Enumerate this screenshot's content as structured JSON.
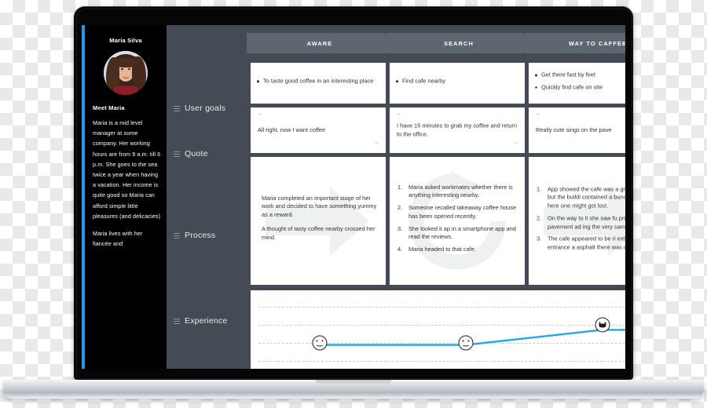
{
  "persona": {
    "name": "Maria Silva",
    "meet_title": "Meet Maria",
    "bio_paragraphs": [
      "Maria is a mid level manager at some company. Her working hours are from 9 a.m. till 6 p.m. She goes to the sea twice a year when having a vacation. Her income is quite good so Maria can afford simple little pleasures (and delicacies)",
      "Maria lives with her fiancée and"
    ]
  },
  "stages": [
    {
      "label": "AWARE"
    },
    {
      "label": "SEARCH"
    },
    {
      "label": "WAY TO CAFFEE"
    }
  ],
  "rows": [
    {
      "label": "User goals"
    },
    {
      "label": "Quote"
    },
    {
      "label": "Process"
    },
    {
      "label": "Experience"
    }
  ],
  "user_goals": [
    {
      "items": [
        "To taste good coffee in an interesting place"
      ]
    },
    {
      "items": [
        "Find cafe nearby"
      ]
    },
    {
      "items": [
        "Get there fast by feet",
        "Quickly find cafe on site"
      ]
    }
  ],
  "quotes": [
    {
      "text": "All right, now I want coffee",
      "open": "“",
      "close": "”"
    },
    {
      "text": "I have 15 minutes to grab my coffee and return to the office.",
      "open": "“",
      "close": "”"
    },
    {
      "text": "Really cute sings on the pave",
      "open": "“",
      "close": "”"
    }
  ],
  "process": [
    {
      "type": "paragraphs",
      "paragraphs": [
        "Maria completed an important stage of her work and decided to have something yummy as a reward.",
        "A thought of tasty coffee nearby crossed her mind."
      ]
    },
    {
      "type": "ordered",
      "items": [
        "Maria asked workmates whether there is anything interesting nearby.",
        "Someone recalled takeaway coffee house has been opened recently.",
        "She looked it ap in a smartphone app and read the reviews.",
        "Maria headed to that cafe."
      ]
    },
    {
      "type": "ordered",
      "items": [
        "App showed the cafe was a ground floor but the buildi contained a bunch of offic here one might got lost.",
        "On the way to it she saw fu prints on the pavement ad ing the very same coffee h",
        "The cafe appeared to be ri ext to the main entrance a asphalt there was quite go"
      ]
    }
  ],
  "chart_data": {
    "type": "line",
    "title": "Experience",
    "categories": [
      "AWARE",
      "SEARCH",
      "WAY TO CAFFEE"
    ],
    "values": [
      2,
      2,
      3
    ],
    "ylim": [
      0,
      5
    ],
    "markers": [
      "neutral-smile",
      "neutral-smile",
      "happy-grin"
    ],
    "line_color": "#1fa8e8",
    "grid": true,
    "gridline_count": 5,
    "xlabel": "",
    "ylabel": ""
  },
  "colors": {
    "accent_blue": "#1d9bf0",
    "chart_line": "#1fa8e8",
    "panel_bg": "#454b55",
    "stage_bg": "#5e6670",
    "sidebar_bg": "#000000",
    "card_bg": "#ffffff",
    "bezel": "#060606"
  }
}
